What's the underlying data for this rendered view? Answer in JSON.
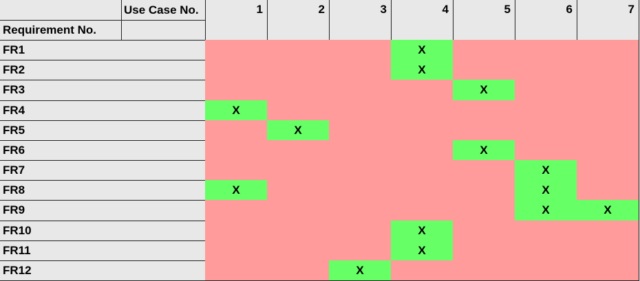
{
  "header": {
    "use_case_label": "Use Case No.",
    "requirement_label": "Requirement No.",
    "use_cases": [
      "1",
      "2",
      "3",
      "4",
      "5",
      "6",
      "7"
    ]
  },
  "colors": {
    "unmapped": "#ff9b9b",
    "mapped": "#66ff66",
    "background": "#e8e8e8"
  },
  "rows": [
    {
      "id": "FR1",
      "marks": [
        "",
        "",
        "",
        "X",
        "",
        "",
        ""
      ]
    },
    {
      "id": "FR2",
      "marks": [
        "",
        "",
        "",
        "X",
        "",
        "",
        ""
      ]
    },
    {
      "id": "FR3",
      "marks": [
        "",
        "",
        "",
        "",
        "X",
        "",
        ""
      ]
    },
    {
      "id": "FR4",
      "marks": [
        "X",
        "",
        "",
        "",
        "",
        "",
        ""
      ]
    },
    {
      "id": "FR5",
      "marks": [
        "",
        "X",
        "",
        "",
        "",
        "",
        ""
      ]
    },
    {
      "id": "FR6",
      "marks": [
        "",
        "",
        "",
        "",
        "X",
        "",
        ""
      ]
    },
    {
      "id": "FR7",
      "marks": [
        "",
        "",
        "",
        "",
        "",
        "X",
        ""
      ]
    },
    {
      "id": "FR8",
      "marks": [
        "X",
        "",
        "",
        "",
        "",
        "X",
        ""
      ]
    },
    {
      "id": "FR9",
      "marks": [
        "",
        "",
        "",
        "",
        "",
        "X",
        "X"
      ]
    },
    {
      "id": "FR10",
      "marks": [
        "",
        "",
        "",
        "X",
        "",
        "",
        ""
      ]
    },
    {
      "id": "FR11",
      "marks": [
        "",
        "",
        "",
        "X",
        "",
        "",
        ""
      ]
    },
    {
      "id": "FR12",
      "marks": [
        "",
        "",
        "X",
        "",
        "",
        "",
        ""
      ]
    }
  ]
}
